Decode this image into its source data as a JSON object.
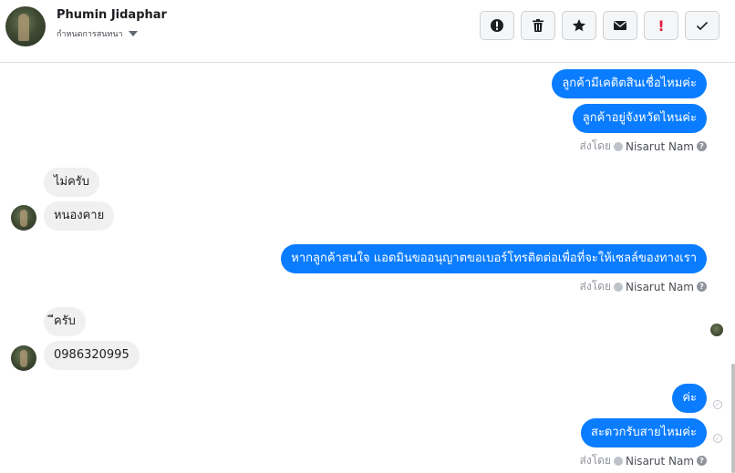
{
  "header": {
    "contact_name": "Phumin Jidaphar",
    "assign_label": "กำหนดการสนทนา",
    "toolbar": [
      {
        "name": "follow-up-button",
        "icon": "alert-circle-icon"
      },
      {
        "name": "delete-button",
        "icon": "trash-icon"
      },
      {
        "name": "star-button",
        "icon": "star-icon"
      },
      {
        "name": "mark-unread-button",
        "icon": "envelope-icon"
      },
      {
        "name": "spam-button",
        "icon": "exclamation-icon",
        "label": "!"
      },
      {
        "name": "mark-done-button",
        "icon": "check-icon"
      }
    ]
  },
  "messages": {
    "out1": "ลูกค้ามีเคดิตสินเชื่อไหมค่ะ",
    "out2": "ลูกค้าอยู่จังหวัดไหนค่ะ",
    "sent_by_1": "ส่งโดย",
    "agent_1": "Nisarut Nam",
    "in1": "ไม่ครับ",
    "in2": "หนองคาย",
    "out3": "หากลูกค้าสนใจ แอดมินขออนุญาตขอเบอร์โทรติดต่อเพื่อที่จะให้เซลล์ของทางเรา",
    "sent_by_2": "ส่งโดย",
    "agent_2": "Nisarut Nam",
    "in3": "ีครับ",
    "in4": "0986320995",
    "out4": "ค่ะ",
    "out5": "สะดวกรับสายไหมค่ะ",
    "sent_by_3": "ส่งโดย",
    "agent_3": "Nisarut Nam",
    "help_mark": "?"
  },
  "colors": {
    "outgoing_bubble": "#0a7cff",
    "incoming_bubble": "#f0f0f0",
    "spam_red": "#e41e3f"
  }
}
